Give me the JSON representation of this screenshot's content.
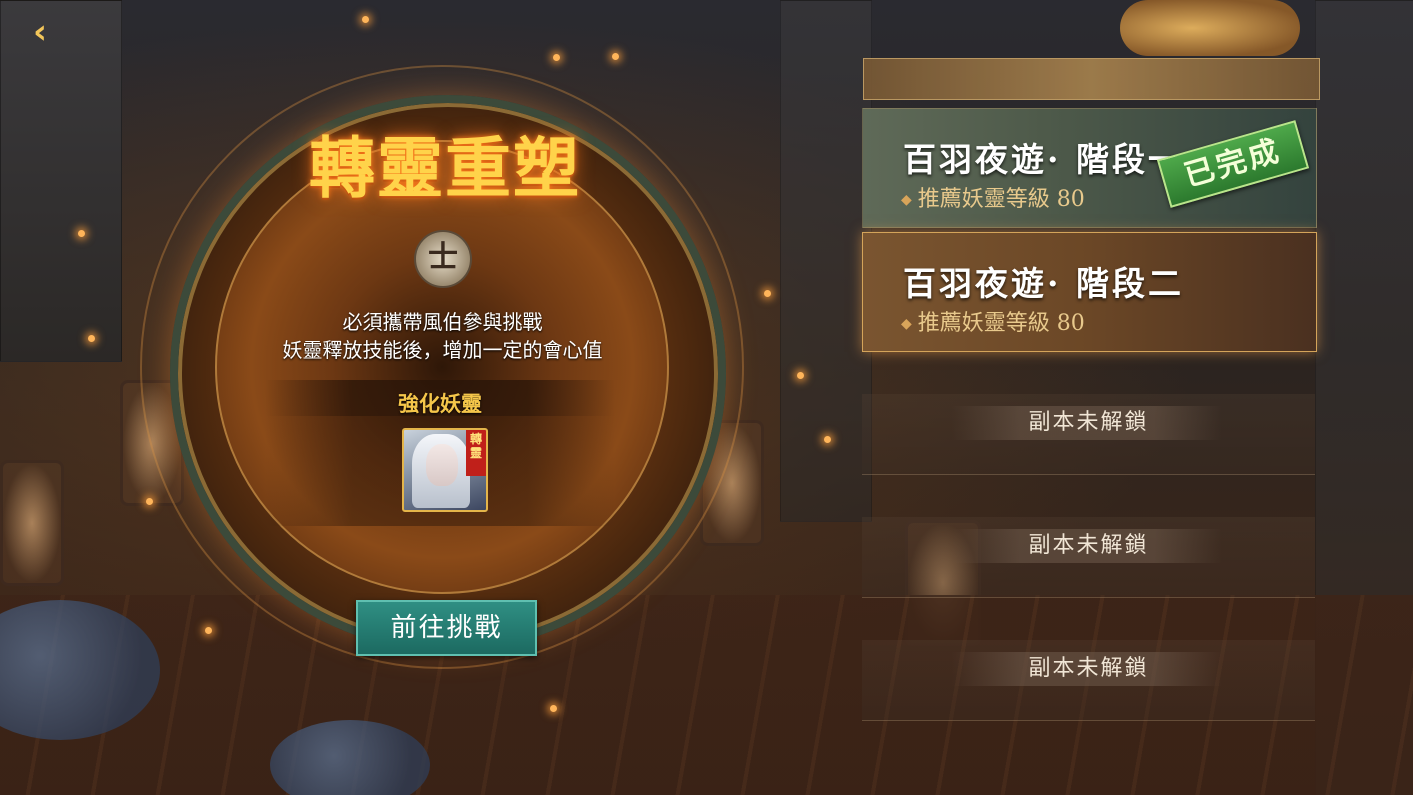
{
  "nav": {
    "back_glyph": "‹"
  },
  "event": {
    "title": "轉靈重塑",
    "emblem_glyph": "士",
    "description_line1": "必須攜帶風伯參與挑戰",
    "description_line2": "妖靈釋放技能後，增加一定的會心值",
    "enhance_label": "強化妖靈",
    "portrait_tag": "轉靈",
    "challenge_button": "前往挑戰"
  },
  "stages": [
    {
      "name": "百羽夜遊· 階段一",
      "sub": "推薦妖靈等級 80",
      "status": "已完成"
    },
    {
      "name": "百羽夜遊· 階段二",
      "sub": "推薦妖靈等級 80"
    }
  ],
  "locked": [
    {
      "label": "副本未解鎖"
    },
    {
      "label": "副本未解鎖"
    },
    {
      "label": "副本未解鎖"
    }
  ],
  "colors": {
    "accent_gold": "#ffd34a",
    "button_teal": "#1c6a61",
    "completed_green": "#2c7a2e"
  }
}
